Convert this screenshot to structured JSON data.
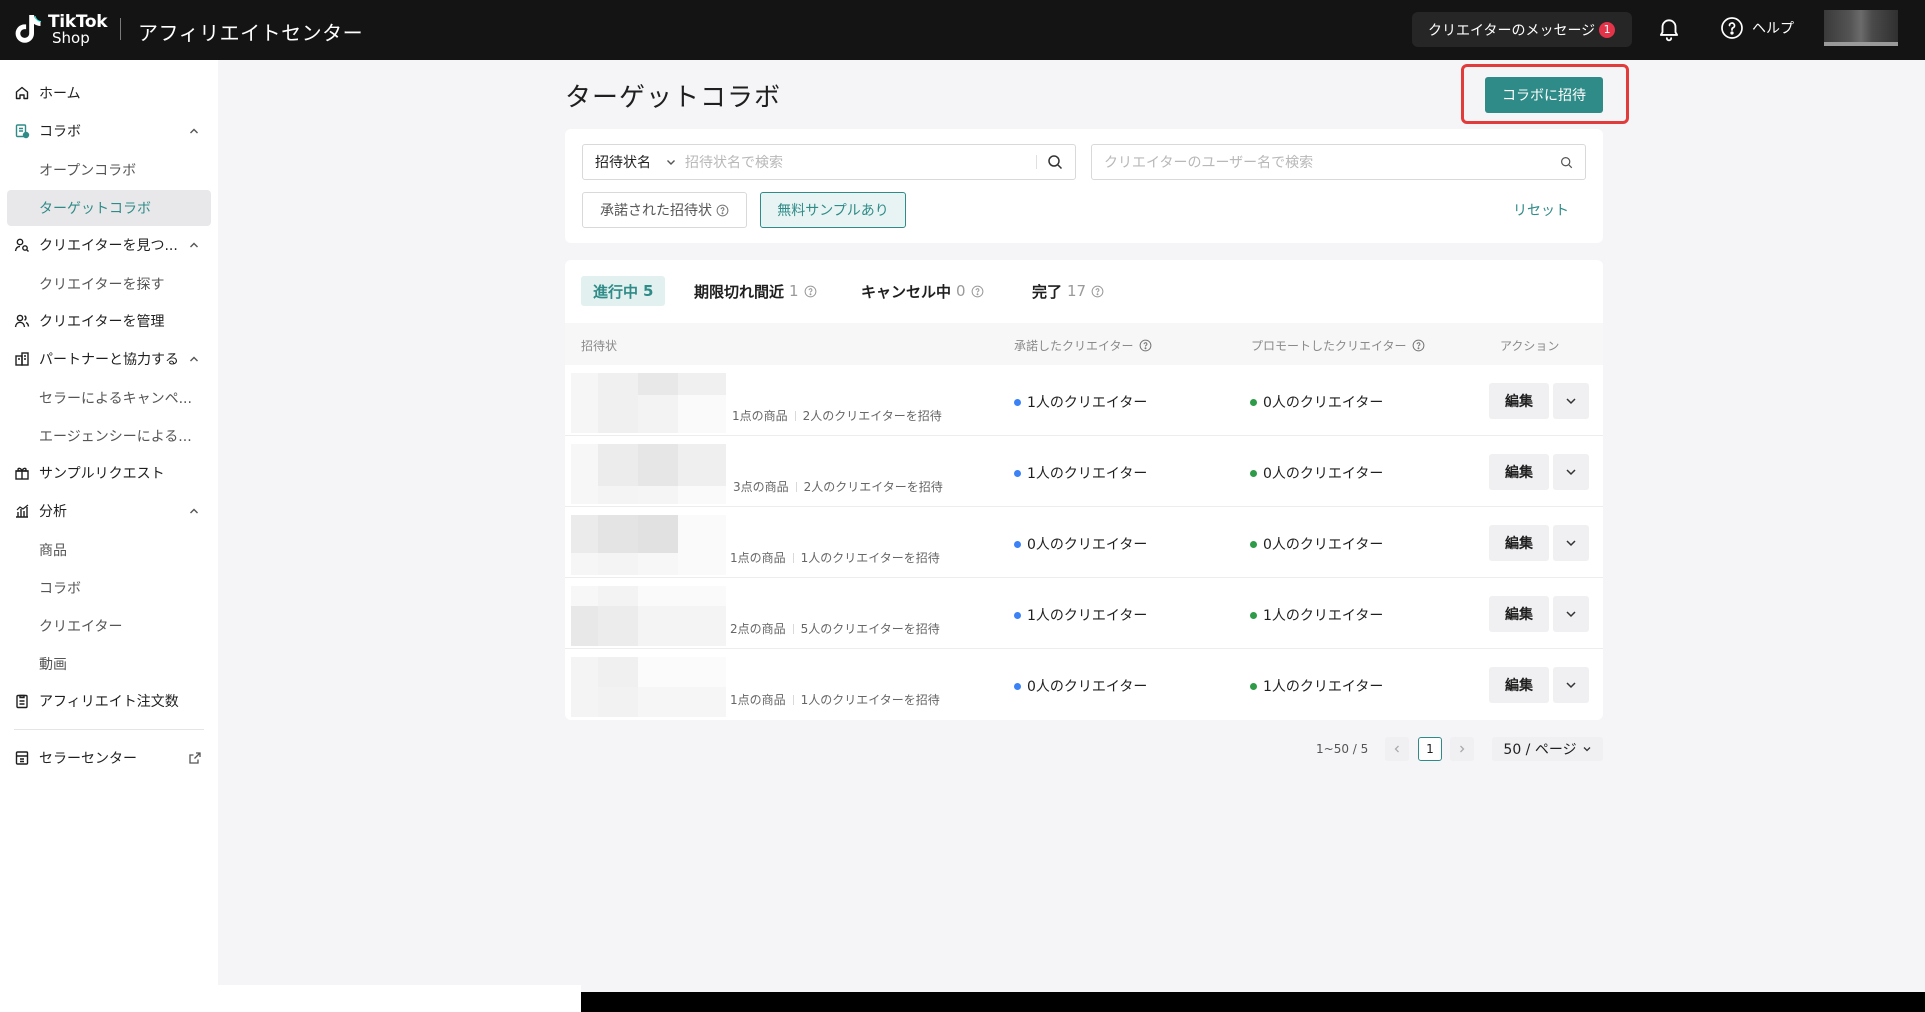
{
  "header": {
    "logo_top": "TikTok",
    "logo_bottom": "Shop",
    "app_title": "アフィリエイトセンター",
    "messages_label": "クリエイターのメッセージ",
    "messages_badge": "1",
    "help_label": "ヘルプ"
  },
  "sidebar": {
    "home": "ホーム",
    "collab": "コラボ",
    "open_collab": "オープンコラボ",
    "target_collab": "ターゲットコラボ",
    "find_creators": "クリエイターを見つ...",
    "search_creators": "クリエイターを探す",
    "manage_creators": "クリエイターを管理",
    "partner": "パートナーと協力する",
    "seller_campaign": "セラーによるキャンペ...",
    "agency": "エージェンシーによる...",
    "sample_requests": "サンプルリクエスト",
    "analytics": "分析",
    "analytics_products": "商品",
    "analytics_collab": "コラボ",
    "analytics_creators": "クリエイター",
    "analytics_videos": "動画",
    "affiliate_orders": "アフィリエイト注文数",
    "seller_center": "セラーセンター"
  },
  "main": {
    "page_title": "ターゲットコラボ",
    "invite_button": "コラボに招待"
  },
  "filters": {
    "select_value": "招待状名",
    "select_placeholder": "招待状名で検索",
    "creator_search_placeholder": "クリエイターのユーザー名で検索",
    "accepted_chip": "承諾された招待状",
    "free_sample_chip": "無料サンプルあり",
    "reset": "リセット"
  },
  "tabs": [
    {
      "label": "進行中",
      "count": "5"
    },
    {
      "label": "期限切れ間近",
      "count": "1"
    },
    {
      "label": "キャンセル中",
      "count": "0"
    },
    {
      "label": "完了",
      "count": "17"
    }
  ],
  "table": {
    "columns": {
      "invitation": "招待状",
      "accepted": "承諾したクリエイター",
      "promoted": "プロモートしたクリエイター",
      "action": "アクション"
    },
    "rows": [
      {
        "products": "1点の商品",
        "invited": "2人のクリエイターを招待",
        "accepted": "1人のクリエイター",
        "promoted": "0人のクリエイター",
        "edit": "編集"
      },
      {
        "products": "3点の商品",
        "invited": "2人のクリエイターを招待",
        "accepted": "1人のクリエイター",
        "promoted": "0人のクリエイター",
        "edit": "編集"
      },
      {
        "products": "1点の商品",
        "invited": "1人のクリエイターを招待",
        "accepted": "0人のクリエイター",
        "promoted": "0人のクリエイター",
        "edit": "編集"
      },
      {
        "products": "2点の商品",
        "invited": "5人のクリエイターを招待",
        "accepted": "1人のクリエイター",
        "promoted": "1人のクリエイター",
        "edit": "編集"
      },
      {
        "products": "1点の商品",
        "invited": "1人のクリエイターを招待",
        "accepted": "0人のクリエイター",
        "promoted": "1人のクリエイター",
        "edit": "編集"
      }
    ]
  },
  "pagination": {
    "range": "1~50 / 5",
    "current_page": "1",
    "page_size": "50 / ページ"
  },
  "colors": {
    "accent": "#2f8b87",
    "highlight": "#e23b3b",
    "accepted_dot": "#3b82f6",
    "promoted_dot": "#2e9b48"
  }
}
